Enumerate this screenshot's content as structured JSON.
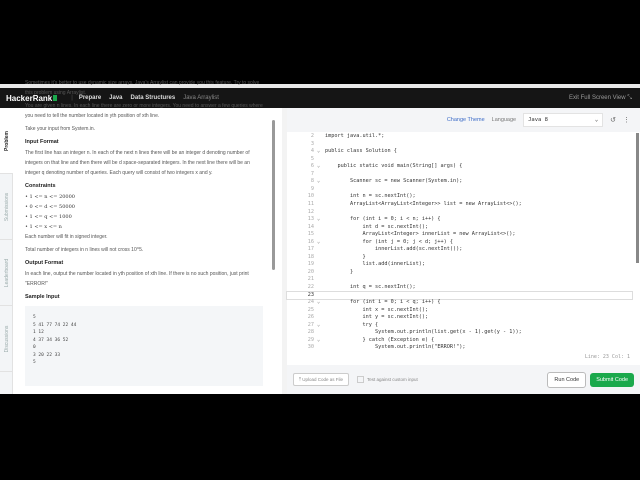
{
  "nav": {
    "logo": "HackerRank",
    "crumbs": [
      "Prepare",
      "Java",
      "Data Structures",
      "Java Arraylist"
    ],
    "exit": "Exit Full Screen View"
  },
  "tabs": [
    "Problem",
    "Submissions",
    "Leaderboard",
    "Discussions"
  ],
  "problem": {
    "intro": "Sometimes it's better to use dynamic size arrays. Java's Arraylist can provide you this feature. Try to solve this problem using Arraylist.",
    "p1": "You are given n lines. In each line there are zero or more integers. You need to answer a few queries where you need to tell the number located in yth position of xth line.",
    "p2": "Take your input from System.in.",
    "input_h": "Input Format",
    "input": "The first line has an integer n. In each of the next n lines there will be an integer d denoting number of integers on that line and then there will be d space-separated integers. In the next line there will be an integer q denoting number of queries. Each query will consist of two integers x and y.",
    "constraints_h": "Constraints",
    "constraints": [
      "1 <= n <= 20000",
      "0 <= d <= 50000",
      "1 <= q <= 1000",
      "1 <= x <= n"
    ],
    "c1": "Each number will fit in signed integer.",
    "c2": "Total number of integers in n lines will not cross 10^5.",
    "output_h": "Output Format",
    "output": "In each line, output the number located in yth position of xth line. If there is no such position, just print \"ERROR!\"",
    "sample_h": "Sample Input",
    "sample": "5\n5 41 77 74 22 44\n1 12\n4 37 34 36 52\n0\n3 20 22 33\n5"
  },
  "editor": {
    "change_theme": "Change Theme",
    "language_label": "Language",
    "language": "Java 8",
    "status": "Line: 23 Col: 1",
    "lines": [
      {
        "n": "2",
        "t": "import java.util.*;"
      },
      {
        "n": "3",
        "t": ""
      },
      {
        "n": "4",
        "t": "public class Solution {",
        "fold": true
      },
      {
        "n": "5",
        "t": ""
      },
      {
        "n": "6",
        "t": "    public static void main(String[] args) {",
        "fold": true
      },
      {
        "n": "7",
        "t": ""
      },
      {
        "n": "8",
        "t": "        Scanner sc = new Scanner(System.in);",
        "fold": true
      },
      {
        "n": "9",
        "t": ""
      },
      {
        "n": "10",
        "t": "        int n = sc.nextInt();"
      },
      {
        "n": "11",
        "t": "        ArrayList<ArrayList<Integer>> list = new ArrayList<>();"
      },
      {
        "n": "12",
        "t": ""
      },
      {
        "n": "13",
        "t": "        for (int i = 0; i < n; i++) {",
        "fold": true
      },
      {
        "n": "14",
        "t": "            int d = sc.nextInt();"
      },
      {
        "n": "15",
        "t": "            ArrayList<Integer> innerList = new ArrayList<>();"
      },
      {
        "n": "16",
        "t": "            for (int j = 0; j < d; j++) {",
        "fold": true
      },
      {
        "n": "17",
        "t": "                innerList.add(sc.nextInt());"
      },
      {
        "n": "18",
        "t": "            }"
      },
      {
        "n": "19",
        "t": "            list.add(innerList);"
      },
      {
        "n": "20",
        "t": "        }"
      },
      {
        "n": "21",
        "t": ""
      },
      {
        "n": "22",
        "t": "        int q = sc.nextInt();"
      },
      {
        "n": "23",
        "t": "",
        "cur": true
      },
      {
        "n": "24",
        "t": "        for (int i = 0; i < q; i++) {",
        "fold": true
      },
      {
        "n": "25",
        "t": "            int x = sc.nextInt();"
      },
      {
        "n": "26",
        "t": "            int y = sc.nextInt();"
      },
      {
        "n": "27",
        "t": "            try {",
        "fold": true
      },
      {
        "n": "28",
        "t": "                System.out.println(list.get(x - 1).get(y - 1));"
      },
      {
        "n": "29",
        "t": "            } catch (Exception e) {",
        "fold": true
      },
      {
        "n": "30",
        "t": "                System.out.println(\"ERROR!\");"
      }
    ]
  },
  "footer": {
    "upload": "Upload Code as File",
    "custom": "Test against custom input",
    "run": "Run Code",
    "submit": "Submit Code"
  }
}
